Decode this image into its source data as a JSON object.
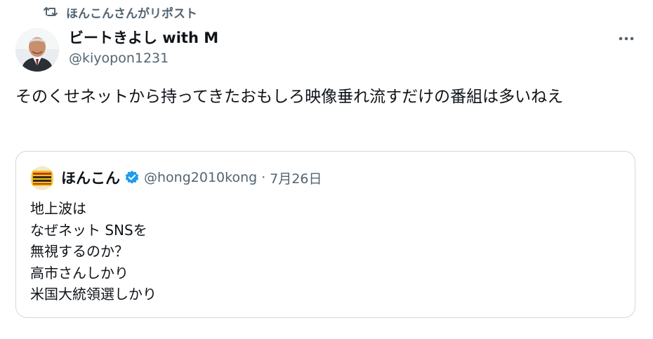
{
  "repost": {
    "icon": "repost-icon",
    "label": "ほんこんさんがリポスト"
  },
  "author": {
    "name": "ビートきよし with M",
    "handle": "@kiyopon1231"
  },
  "tweet": {
    "text": "そのくせネットから持ってきたおもしろ映像垂れ流すだけの番組は多いねえ"
  },
  "quote": {
    "name": "ほんこん",
    "verified_color": "#1d9bf0",
    "handle": "@hong2010kong",
    "separator": "·",
    "date": "7月26日",
    "lines": [
      "地上波は",
      "なぜネット SNSを",
      "無視するのか？",
      "高市さんしかり",
      "米国大統領選しかり"
    ]
  },
  "colors": {
    "text": "#0f1419",
    "secondary": "#536471",
    "border": "#cfd9de"
  }
}
